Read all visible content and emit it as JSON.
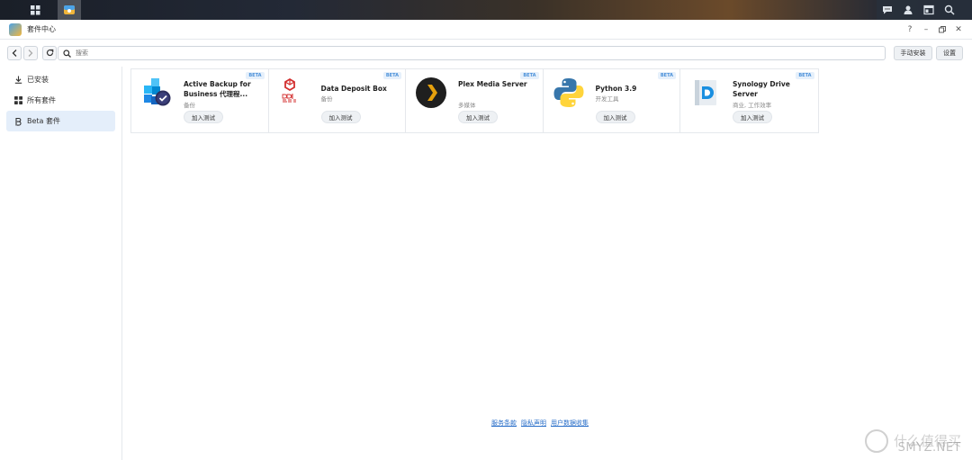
{
  "window": {
    "title": "套件中心"
  },
  "toolbar": {
    "search_placeholder": "搜索",
    "manual_install_label": "手动安装",
    "settings_label": "设置"
  },
  "sidebar": {
    "items": [
      {
        "label": "已安装",
        "icon": "download-icon"
      },
      {
        "label": "所有套件",
        "icon": "grid-icon"
      },
      {
        "label": "Beta 套件",
        "icon": "beta-icon",
        "active": true
      }
    ]
  },
  "packages": [
    {
      "name": "Active Backup for Business 代理程...",
      "category": "备份",
      "badge": "BETA",
      "button": "加入测试",
      "icon": "active-backup-icon"
    },
    {
      "name": "Data Deposit Box",
      "category": "备份",
      "badge": "BETA",
      "button": "加入测试",
      "icon": "data-deposit-box-icon"
    },
    {
      "name": "Plex Media Server",
      "category": "多媒体",
      "badge": "BETA",
      "button": "加入测试",
      "icon": "plex-icon"
    },
    {
      "name": "Python 3.9",
      "category": "开发工具",
      "badge": "BETA",
      "button": "加入测试",
      "icon": "python-icon"
    },
    {
      "name": "Synology Drive Server",
      "category": "商业, 工作效率",
      "badge": "BETA",
      "button": "加入测试",
      "icon": "synology-drive-icon"
    }
  ],
  "footer": {
    "terms": "服务条款",
    "privacy": "隐私声明",
    "data_collection": "用户数据收集"
  },
  "watermark": {
    "text": "什么值得买",
    "site": "SMYZ.NET"
  },
  "colors": {
    "accent": "#2a6fc9",
    "active_bg": "#e4eefa"
  }
}
